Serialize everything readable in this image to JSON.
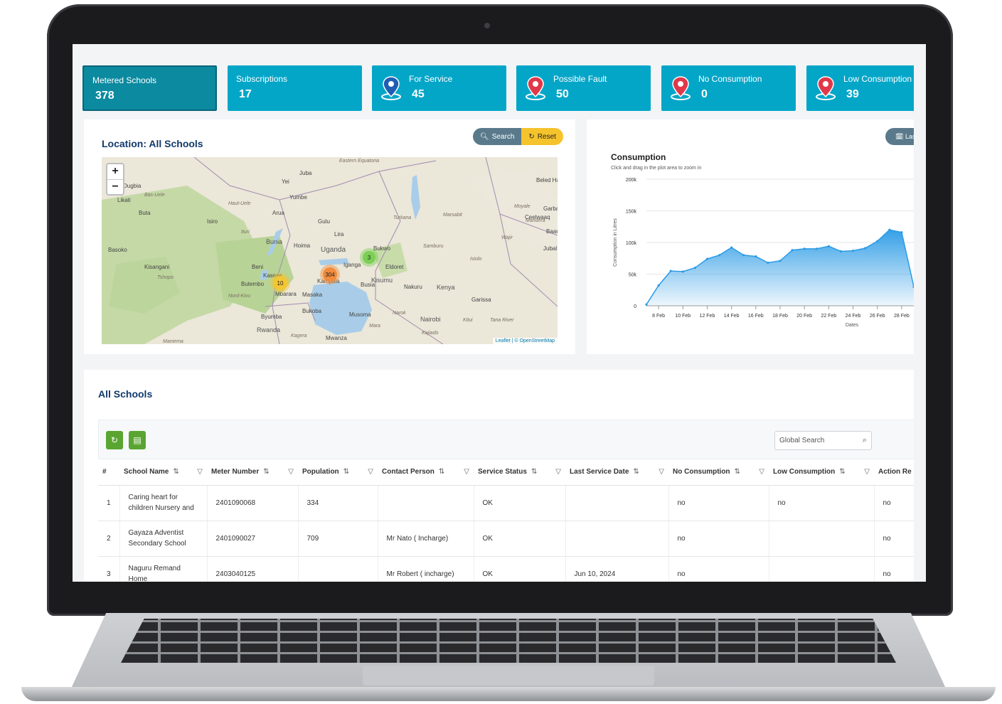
{
  "stats": [
    {
      "title": "Metered Schools",
      "value": "378",
      "icon": "none"
    },
    {
      "title": "Subscriptions",
      "value": "17",
      "icon": "none"
    },
    {
      "title": "For Service",
      "value": "45",
      "icon": "map-pin-blue"
    },
    {
      "title": "Possible Fault",
      "value": "50",
      "icon": "map-pin-red"
    },
    {
      "title": "No Consumption",
      "value": "0",
      "icon": "map-pin-red"
    },
    {
      "title": "Low Consumption",
      "value": "39",
      "icon": "map-pin-red"
    }
  ],
  "map_panel": {
    "title": "Location: All Schools",
    "search_label": "Search",
    "reset_label": "Reset",
    "zoom_in": "+",
    "zoom_out": "−",
    "attribution_leaflet": "Leaflet",
    "attribution_osm": "| © OpenStreetMap",
    "clusters": [
      {
        "label": "304",
        "color": "#f08c3c"
      },
      {
        "label": "10",
        "color": "#f3c634"
      },
      {
        "label": "3",
        "color": "#7bcf55"
      }
    ],
    "places": [
      "Juba",
      "Uganda",
      "Kampala",
      "Kisumu",
      "Kenya",
      "Nairobi",
      "Mwanza",
      "Rwanda",
      "Gulu",
      "Lira",
      "Hoima",
      "Bunia",
      "Busia",
      "Eldoret",
      "Nakuru",
      "Masaka",
      "Mbarara",
      "Bukoba",
      "Musoma",
      "Yei",
      "Yumbe",
      "Arua",
      "Isiro",
      "Beni",
      "Butembo",
      "Kasese",
      "Kisangani",
      "Basoko",
      "Buta",
      "Likati",
      "Dugbia",
      "Garissa",
      "Wajir",
      "Marsabit",
      "Moyale",
      "Turkana",
      "Samburu",
      "Isiolo",
      "Kitui",
      "Narok",
      "Kajiado",
      "Kagera",
      "Mara",
      "Iganga",
      "Bukwo",
      "Byumba",
      "Nord-Kivu",
      "Tshopo",
      "Bas-Uele",
      "Haut-Uele",
      "Ituri",
      "Eastern Equatoria",
      "Mandera",
      "Tana River",
      "Maniema",
      "Beled Ha",
      "Garba",
      "Baar",
      "Jubal",
      "Ceelwaaq"
    ]
  },
  "chart_panel": {
    "button_label": "Las",
    "title": "Consumption",
    "subtitle": "Click and drag in the plot area to zoom in"
  },
  "chart_data": {
    "type": "area",
    "title": "Consumption",
    "subtitle": "Click and drag in the plot area to zoom in",
    "xlabel": "Dates",
    "ylabel": "Consumption in Litres",
    "ylim": [
      0,
      200000
    ],
    "yticks": [
      "0",
      "50k",
      "100k",
      "150k",
      "200k"
    ],
    "xticks": [
      "8 Feb",
      "10 Feb",
      "12 Feb",
      "14 Feb",
      "16 Feb",
      "18 Feb",
      "20 Feb",
      "22 Feb",
      "24 Feb",
      "26 Feb",
      "28 Feb"
    ],
    "series": [
      {
        "color": "#2b9be6",
        "x": [
          7,
          8,
          9,
          10,
          11,
          12,
          13,
          14,
          15,
          16,
          17,
          18,
          19,
          20,
          21,
          22,
          23,
          24,
          25,
          26,
          27,
          28,
          29
        ],
        "values": [
          2000,
          32000,
          55000,
          54000,
          60000,
          74000,
          80000,
          92000,
          80000,
          78000,
          68000,
          71000,
          88000,
          90000,
          90000,
          94000,
          86000,
          87000,
          91000,
          102000,
          120000,
          116000,
          30000
        ]
      }
    ],
    "grid": true,
    "legend": "none"
  },
  "table_panel": {
    "title": "All Schools",
    "refresh_label": "↻",
    "export_label": "▤",
    "search_placeholder": "Global Search",
    "columns": [
      "#",
      "School Name",
      "Meter Number",
      "Population",
      "Contact Person",
      "Service Status",
      "Last Service Date",
      "No Consumption",
      "Low Consumption",
      "Action Re"
    ],
    "rows": [
      [
        "1",
        "Caring heart for children Nursery and",
        "2401090068",
        "334",
        "",
        "OK",
        "",
        "no",
        "no",
        "no"
      ],
      [
        "2",
        "Gayaza Adventist Secondary School",
        "2401090027",
        "709",
        "Mr Nato ( Incharge)",
        "OK",
        "",
        "no",
        "",
        "no"
      ],
      [
        "3",
        "Naguru Remand Home",
        "2403040125",
        "",
        "Mr Robert ( incharge)",
        "OK",
        "Jun 10, 2024",
        "no",
        "",
        "no"
      ]
    ]
  }
}
